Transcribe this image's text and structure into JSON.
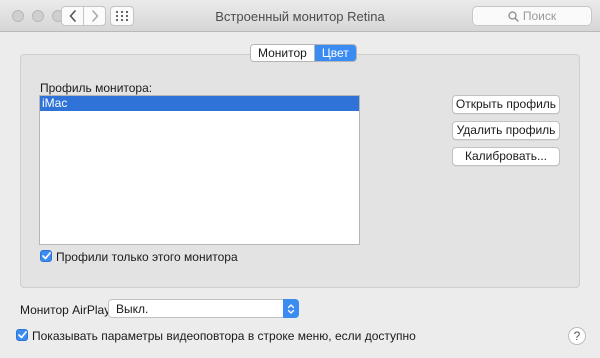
{
  "window": {
    "title": "Встроенный монитор Retina"
  },
  "toolbar": {
    "search_placeholder": "Поиск"
  },
  "tabs": [
    {
      "label": "Монитор",
      "selected": false
    },
    {
      "label": "Цвет",
      "selected": true
    }
  ],
  "profile": {
    "label": "Профиль монитора:",
    "items": [
      {
        "label": "iMac",
        "selected": true
      }
    ],
    "only_this_monitor": {
      "label": "Профили только этого монитора",
      "checked": true
    }
  },
  "buttons": {
    "open": "Открыть профиль",
    "delete": "Удалить профиль",
    "calibrate": "Калибровать..."
  },
  "airplay": {
    "label": "Монитор AirPlay:",
    "value": "Выкл."
  },
  "mirroring": {
    "label": "Показывать параметры видеоповтора в строке меню, если доступно",
    "checked": true
  },
  "help": {
    "label": "?"
  },
  "colors": {
    "accent": "#3a8bf2",
    "selection": "#2f72d8",
    "window_bg": "#ececec"
  }
}
